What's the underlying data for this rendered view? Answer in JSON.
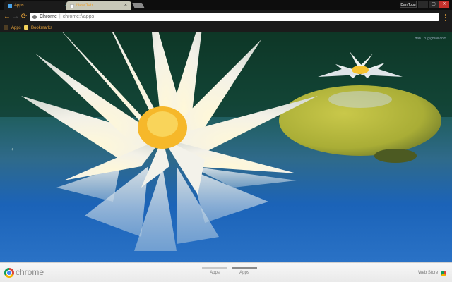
{
  "tabs": [
    {
      "label": "Apps",
      "active": true
    },
    {
      "label": "New Tab",
      "active": false
    }
  ],
  "window": {
    "profile_label": "DaniTogg",
    "buttons": [
      "minimize",
      "maximize",
      "close"
    ]
  },
  "toolbar": {
    "back_icon": "back-arrow-icon",
    "forward_icon": "forward-arrow-icon",
    "reload_icon": "reload-icon",
    "omnibox_scheme": "Chrome",
    "omnibox_url": "chrome://apps"
  },
  "bookmarks": {
    "apps_label": "Apps",
    "bookmarks_label": "Bookmarks"
  },
  "content": {
    "account_text": "dan...d.@gmail.com",
    "left_arrow": "‹",
    "wallpaper": "white water lily on blue water"
  },
  "footer": {
    "brand": "chrome",
    "page_tabs": [
      "Apps",
      "Apps"
    ],
    "selected_page_tab": 1,
    "webstore_label": "Web Store"
  },
  "colors": {
    "accent": "#e8a33a",
    "close": "#c2302b",
    "water": "#1b63b8"
  }
}
